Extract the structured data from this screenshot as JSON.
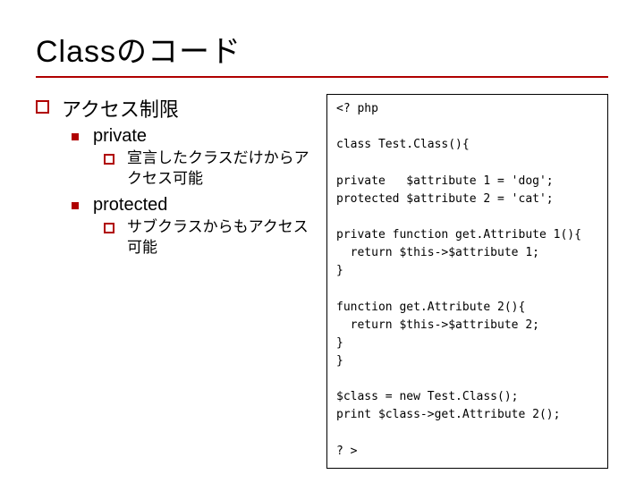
{
  "title": "Classのコード",
  "outline": {
    "l1": "アクセス制限",
    "item1": {
      "label": "private",
      "desc": "宣言したクラスだけからアクセス可能"
    },
    "item2": {
      "label": "protected",
      "desc": "サブクラスからもアクセス可能"
    }
  },
  "code": {
    "l1": "<? php",
    "l2": "",
    "l3": "class Test.Class(){",
    "l4": "",
    "l5": "private   $attribute 1 = 'dog';",
    "l6": "protected $attribute 2 = 'cat';",
    "l7": "",
    "l8": "private function get.Attribute 1(){",
    "l9": "  return $this->$attribute 1;",
    "l10": "}",
    "l11": "",
    "l12": "function get.Attribute 2(){",
    "l13": "  return $this->$attribute 2;",
    "l14": "}",
    "l15": "}",
    "l16": "",
    "l17": "$class = new Test.Class();",
    "l18": "print $class->get.Attribute 2();",
    "l19": "",
    "l20": "? >"
  }
}
